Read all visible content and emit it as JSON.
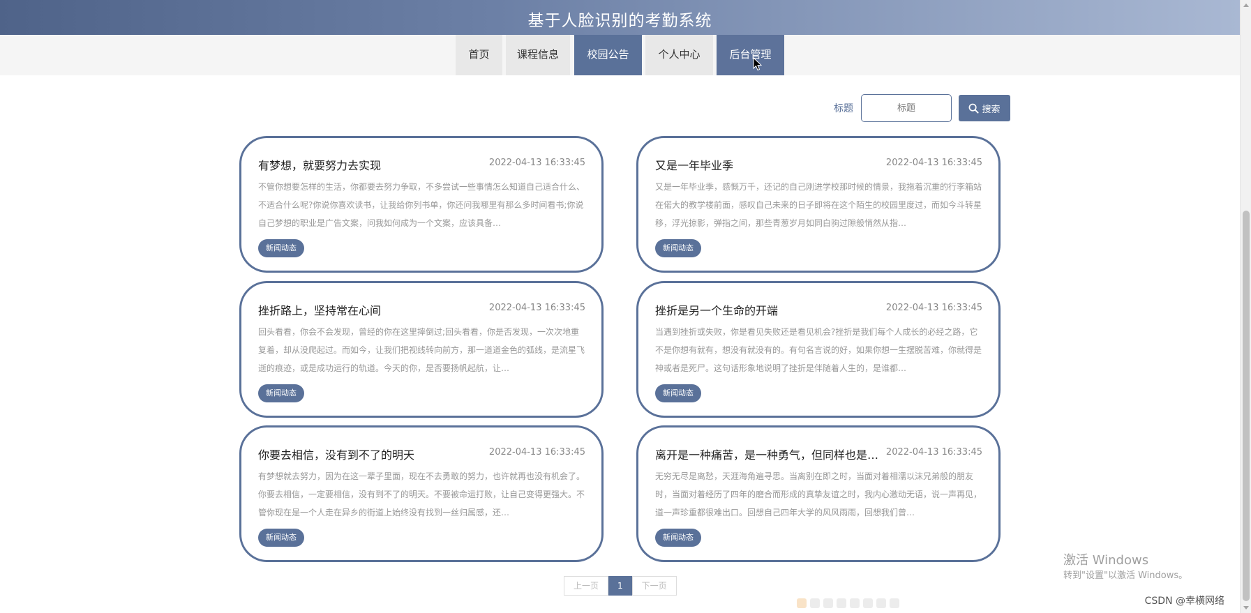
{
  "header": {
    "title": "基于人脸识别的考勤系统"
  },
  "nav": {
    "items": [
      {
        "label": "首页"
      },
      {
        "label": "课程信息"
      },
      {
        "label": "校园公告"
      },
      {
        "label": "个人中心"
      },
      {
        "label": "后台管理"
      }
    ]
  },
  "search": {
    "label": "标题",
    "placeholder": "标题",
    "button_label": "搜索"
  },
  "cards": [
    {
      "title": "有梦想，就要努力去实现",
      "time": "2022-04-13 16:33:45",
      "desc": "不管你想要怎样的生活，你都要去努力争取，不多尝试一些事情怎么知道自己适合什么、不适合什么呢?你说你喜欢读书，让我给你列书单，你还问我哪里有那么多时间看书;你说自己梦想的职业是广告文案，问我如何成为一个文案，应该具备…",
      "tag": "新闻动态"
    },
    {
      "title": "又是一年毕业季",
      "time": "2022-04-13 16:33:45",
      "desc": "又是一年毕业季，感慨万千，还记的自己刚进学校那时候的情景，我拖着沉重的行李箱站在偌大的教学楼前面，感叹自己未来的日子即将在这个陌生的校园里度过，而如今斗转星移，浮光掠影，弹指之间，那些青葱岁月如同白驹过隙般悄然从指…",
      "tag": "新闻动态"
    },
    {
      "title": "挫折路上，坚持常在心间",
      "time": "2022-04-13 16:33:45",
      "desc": "回头看看，你会不会发现，曾经的你在这里摔倒过;回头看看，你是否发现，一次次地重复着，却从没爬起过。而如今，让我们把视线转向前方，那一道道金色的弧线，是流星飞逝的痕迹，或是成功运行的轨道。今天的你，是否要扬帆起航，让…",
      "tag": "新闻动态"
    },
    {
      "title": "挫折是另一个生命的开端",
      "time": "2022-04-13 16:33:45",
      "desc": "当遇到挫折或失败，你是看见失败还是看见机会?挫折是我们每个人成长的必经之路，它不是你想有就有，想没有就没有的。有句名言说的好，如果你想一生摆脱苦难，你就得是神或者是死尸。这句话形象地说明了挫折是伴随着人生的，是谁都…",
      "tag": "新闻动态"
    },
    {
      "title": "你要去相信，没有到不了的明天",
      "time": "2022-04-13 16:33:45",
      "desc": "有梦想就去努力，因为在这一辈子里面，现在不去勇敢的努力，也许就再也没有机会了。你要去相信，一定要相信，没有到不了的明天。不要被命运打败，让自己变得更强大。不管你现在是一个人走在异乡的街道上始终没有找到一丝归属感，还…",
      "tag": "新闻动态"
    },
    {
      "title": "离开是一种痛苦，是一种勇气，但同样也是…",
      "time": "2022-04-13 16:33:45",
      "desc": "无穷无尽是离愁，天涯海角遍寻思。当离别在即之时，当面对着相濡以沫兄弟般的朋友时，当面对着经历了四年的磨合而形成的真挚友谊之时，我内心激动无语，说一声再见，道一声珍重都很难出口。回想自己四年大学的风风雨雨，回想我们曾…",
      "tag": "新闻动态"
    }
  ],
  "pager": {
    "prev": "上一页",
    "current": "1",
    "next": "下一页"
  },
  "watermark": {
    "line1": "激活 Windows",
    "line2": "转到\"设置\"以激活 Windows。"
  },
  "credit": "CSDN @幸横网络",
  "colors": {
    "primary": "#5a7199",
    "header_start": "#4f6389",
    "header_end": "#a9b8d3"
  }
}
